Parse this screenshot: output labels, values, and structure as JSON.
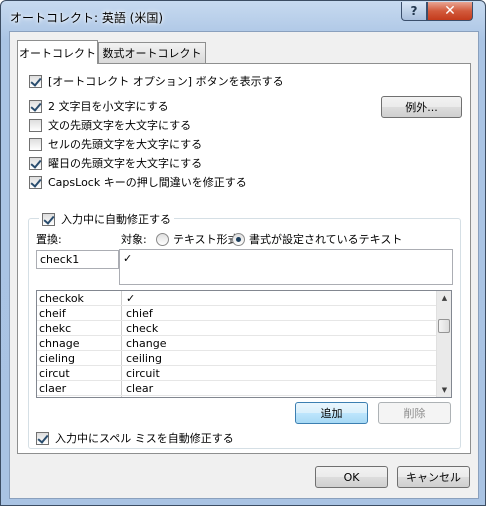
{
  "window": {
    "title": "オートコレクト: 英語 (米国)",
    "help_glyph": "?",
    "close_glyph": "✕"
  },
  "tabs": [
    {
      "label": "オートコレクト",
      "active": true
    },
    {
      "label": "数式オートコレクト",
      "active": false
    }
  ],
  "options": {
    "show_buttons": {
      "label": "[オートコレクト オプション] ボタンを表示する",
      "checked": true
    },
    "two_initial_caps": {
      "label": "2 文字目を小文字にする",
      "checked": true
    },
    "capitalize_sentence": {
      "label": "文の先頭文字を大文字にする",
      "checked": false
    },
    "capitalize_cell": {
      "label": "セルの先頭文字を大文字にする",
      "checked": false
    },
    "capitalize_days": {
      "label": "曜日の先頭文字を大文字にする",
      "checked": true
    },
    "caps_lock": {
      "label": "CapsLock キーの押し間違いを修正する",
      "checked": true
    },
    "exceptions_button": "例外..."
  },
  "replace_group": {
    "title": "入力中に自動修正する",
    "title_checked": true,
    "replace_label": "置換:",
    "with_label": "対象:",
    "radio_plain": {
      "label": "テキスト形式",
      "checked": false
    },
    "radio_formatted": {
      "label": "書式が設定されているテキスト",
      "checked": true
    },
    "replace_value": "check1",
    "with_value": "✓",
    "entries": [
      {
        "replace": "checkok",
        "with": "✓"
      },
      {
        "replace": "cheif",
        "with": "chief"
      },
      {
        "replace": "chekc",
        "with": "check"
      },
      {
        "replace": "chnage",
        "with": "change"
      },
      {
        "replace": "cieling",
        "with": "ceiling"
      },
      {
        "replace": "circut",
        "with": "circuit"
      },
      {
        "replace": "claer",
        "with": "clear"
      }
    ],
    "add_button": "追加",
    "delete_button": "削除"
  },
  "spelling": {
    "label": "入力中にスペル ミスを自動修正する",
    "checked": true
  },
  "footer": {
    "ok_button": "OK",
    "cancel_button": "キャンセル"
  }
}
